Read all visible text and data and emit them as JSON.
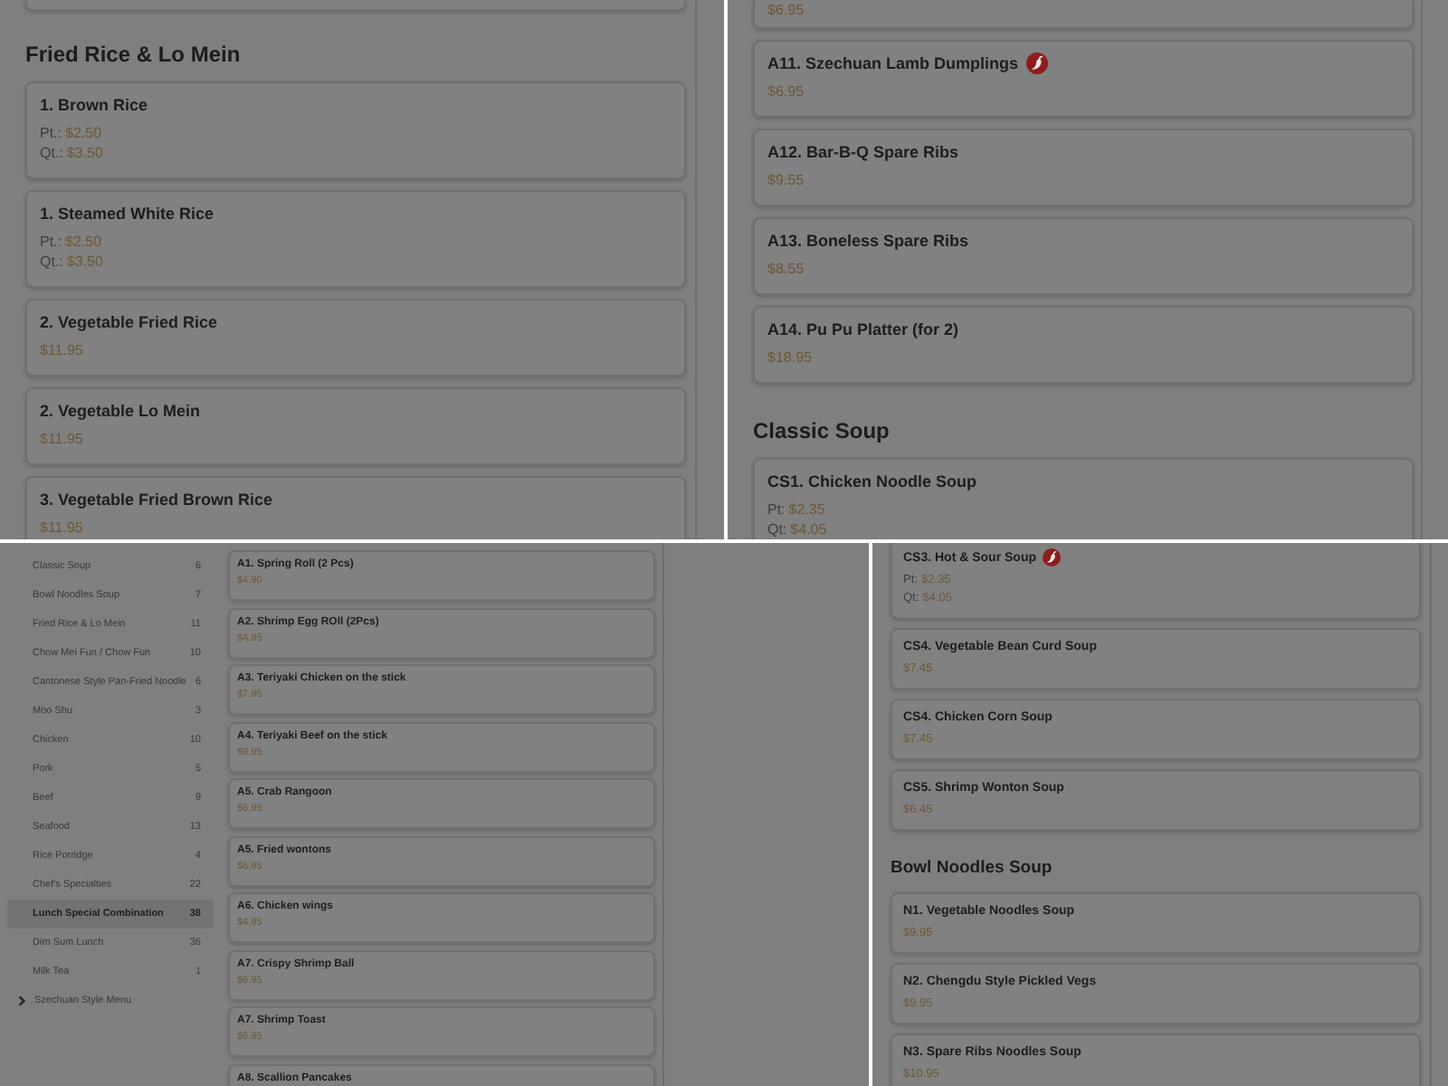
{
  "panels": [
    {
      "blocks": [
        {
          "kind": "card_end"
        },
        {
          "kind": "heading",
          "text": "Fried Rice & Lo Mein"
        },
        {
          "kind": "item",
          "name": "1. Brown Rice",
          "spicy": false,
          "prices": [
            {
              "label": "Pt.:",
              "value": "$2.50"
            },
            {
              "label": "Qt.:",
              "value": "$3.50"
            }
          ]
        },
        {
          "kind": "item",
          "name": "1. Steamed White Rice",
          "spicy": false,
          "prices": [
            {
              "label": "Pt.:",
              "value": "$2.50"
            },
            {
              "label": "Qt.:",
              "value": "$3.50"
            }
          ]
        },
        {
          "kind": "item",
          "name": "2. Vegetable Fried Rice",
          "spicy": false,
          "prices": [
            {
              "value": "$11.95"
            }
          ]
        },
        {
          "kind": "item",
          "name": "2. Vegetable Lo Mein",
          "spicy": false,
          "prices": [
            {
              "value": "$11.95"
            }
          ]
        },
        {
          "kind": "item",
          "name": "3. Vegetable Fried Brown Rice",
          "spicy": false,
          "prices": [
            {
              "value": "$11.95"
            }
          ]
        }
      ]
    },
    {
      "blocks": [
        {
          "kind": "item",
          "prices": [
            {
              "value": "$6.95"
            }
          ]
        },
        {
          "kind": "item",
          "name": "A11. Szechuan Lamb Dumplings",
          "spicy": true,
          "prices": [
            {
              "value": "$6.95"
            }
          ]
        },
        {
          "kind": "item",
          "name": "A12. Bar-B-Q Spare Ribs",
          "spicy": false,
          "prices": [
            {
              "value": "$9.55"
            }
          ]
        },
        {
          "kind": "item",
          "name": "A13. Boneless Spare Ribs",
          "spicy": false,
          "prices": [
            {
              "value": "$8.55"
            }
          ]
        },
        {
          "kind": "item",
          "name": "A14. Pu Pu Platter (for 2)",
          "spicy": false,
          "prices": [
            {
              "value": "$18.95"
            }
          ]
        },
        {
          "kind": "heading",
          "text": "Classic Soup"
        },
        {
          "kind": "item",
          "name": "CS1. Chicken Noodle Soup",
          "spicy": false,
          "prices": [
            {
              "label": "Pt:",
              "value": "$2.35"
            },
            {
              "label": "Qt:",
              "value": "$4.05"
            }
          ]
        }
      ]
    },
    {
      "sidebar": {
        "categories": [
          {
            "name": "Classic Soup",
            "count": "6",
            "selected": false
          },
          {
            "name": "Bowl Noodles Soup",
            "count": "7",
            "selected": false
          },
          {
            "name": "Fried Rice & Lo Mein",
            "count": "11",
            "selected": false
          },
          {
            "name": "Chow Mei Fun / Chow Fun",
            "count": "10",
            "selected": false
          },
          {
            "name": "Cantonese Style Pan-Fried Noodle",
            "count": "6",
            "selected": false
          },
          {
            "name": "Moo Shu",
            "count": "3",
            "selected": false
          },
          {
            "name": "Chicken",
            "count": "10",
            "selected": false
          },
          {
            "name": "Pork",
            "count": "5",
            "selected": false
          },
          {
            "name": "Beef",
            "count": "9",
            "selected": false
          },
          {
            "name": "Seafood",
            "count": "13",
            "selected": false
          },
          {
            "name": "Rice Porridge",
            "count": "4",
            "selected": false
          },
          {
            "name": "Chef's Specialties",
            "count": "22",
            "selected": false
          },
          {
            "name": "Lunch Special Combination",
            "count": "38",
            "selected": true
          },
          {
            "name": "Dim Sum Lunch",
            "count": "36",
            "selected": false
          },
          {
            "name": "Milk Tea",
            "count": "1",
            "selected": false
          }
        ],
        "groups": [
          {
            "name": "Szechuan Style Menu",
            "expanded": false
          }
        ]
      },
      "blocks": [
        {
          "kind": "item",
          "name": "A1. Spring Roll (2 Pcs)",
          "spicy": false,
          "prices": [
            {
              "value": "$4.90"
            }
          ]
        },
        {
          "kind": "item",
          "name": "A2. Shrimp Egg ROll (2Pcs)",
          "spicy": false,
          "prices": [
            {
              "value": "$4.95"
            }
          ]
        },
        {
          "kind": "item",
          "name": "A3. Teriyaki Chicken on the stick",
          "spicy": false,
          "prices": [
            {
              "value": "$7.95"
            }
          ]
        },
        {
          "kind": "item",
          "name": "A4. Teriyaki Beef on the stick",
          "spicy": false,
          "prices": [
            {
              "value": "$9.95"
            }
          ]
        },
        {
          "kind": "item",
          "name": "A5. Crab Rangoon",
          "spicy": false,
          "prices": [
            {
              "value": "$6.95"
            }
          ]
        },
        {
          "kind": "item",
          "name": "A5. Fried wontons",
          "spicy": false,
          "prices": [
            {
              "value": "$6.95"
            }
          ]
        },
        {
          "kind": "item",
          "name": "A6. Chicken wings",
          "spicy": false,
          "prices": [
            {
              "value": "$4.95"
            }
          ]
        },
        {
          "kind": "item",
          "name": "A7. Crispy Shrimp Ball",
          "spicy": false,
          "prices": [
            {
              "value": "$6.95"
            }
          ]
        },
        {
          "kind": "item",
          "name": "A7. Shrimp Toast",
          "spicy": false,
          "prices": [
            {
              "value": "$6.95"
            }
          ]
        },
        {
          "kind": "item",
          "name": "A8. Scallion Pancakes",
          "spicy": false
        }
      ]
    },
    {
      "blocks": [
        {
          "kind": "item",
          "name": "CS3. Hot & Sour Soup",
          "spicy": true,
          "prices": [
            {
              "label": "Pt:",
              "value": "$2.35"
            },
            {
              "label": "Qt:",
              "value": "$4.05"
            }
          ]
        },
        {
          "kind": "item",
          "name": "CS4. Vegetable Bean Curd Soup",
          "spicy": false,
          "prices": [
            {
              "value": "$7.45"
            }
          ]
        },
        {
          "kind": "item",
          "name": "CS4. Chicken Corn Soup",
          "spicy": false,
          "prices": [
            {
              "value": "$7.45"
            }
          ]
        },
        {
          "kind": "item",
          "name": "CS5. Shrimp Wonton Soup",
          "spicy": false,
          "prices": [
            {
              "value": "$6.45"
            }
          ]
        },
        {
          "kind": "heading",
          "text": "Bowl Noodles Soup"
        },
        {
          "kind": "item",
          "name": "N1. Vegetable Noodles Soup",
          "spicy": false,
          "prices": [
            {
              "value": "$9.95"
            }
          ]
        },
        {
          "kind": "item",
          "name": "N2. Chengdu Style Pickled Vegs",
          "spicy": false,
          "prices": [
            {
              "value": "$9.95"
            }
          ]
        },
        {
          "kind": "item",
          "name": "N3. Spare Ribs Noodles Soup",
          "spicy": false,
          "prices": [
            {
              "value": "$10.95"
            }
          ]
        }
      ]
    }
  ]
}
